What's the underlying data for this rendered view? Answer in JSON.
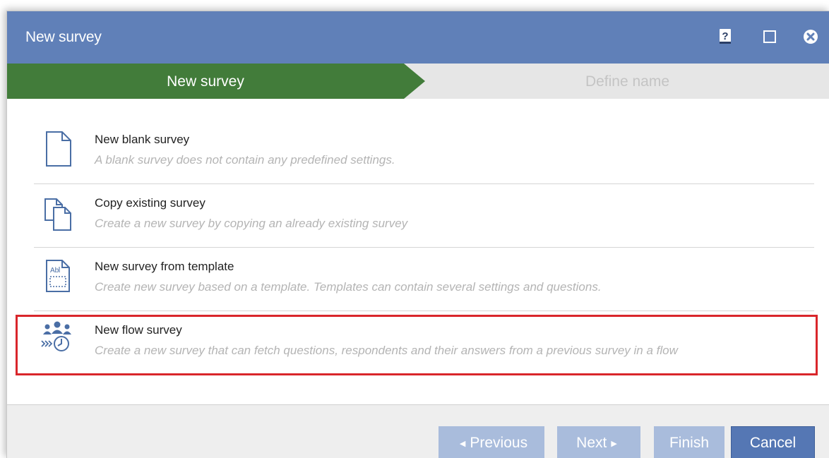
{
  "window": {
    "title": "New survey",
    "controls": [
      "help-icon",
      "maximize-icon",
      "close-icon"
    ]
  },
  "wizard": {
    "steps": [
      {
        "label": "New survey",
        "state": "active"
      },
      {
        "label": "Define name",
        "state": "inactive"
      }
    ]
  },
  "options": [
    {
      "title": "New blank survey",
      "description": "A blank survey does not contain any predefined settings.",
      "icon": "blank-document-icon"
    },
    {
      "title": "Copy existing survey",
      "description": "Create a new survey by copying an already existing survey",
      "icon": "copy-documents-icon"
    },
    {
      "title": "New survey from template",
      "description": "Create new survey based on a template. Templates can contain several settings and questions.",
      "icon": "template-document-icon"
    },
    {
      "title": "New flow survey",
      "description": "Create a new survey that can fetch questions, respondents and their answers from a previous survey in a flow",
      "icon": "flow-survey-icon",
      "highlighted": true
    }
  ],
  "buttons": {
    "previous": "Previous",
    "next": "Next",
    "finish": "Finish",
    "cancel": "Cancel"
  },
  "colors": {
    "titlebar": "#6080b8",
    "active_step": "#427c3a",
    "highlight": "#d9262b",
    "primary_button": "#5577b4",
    "disabled_button": "#a9bcdc"
  }
}
